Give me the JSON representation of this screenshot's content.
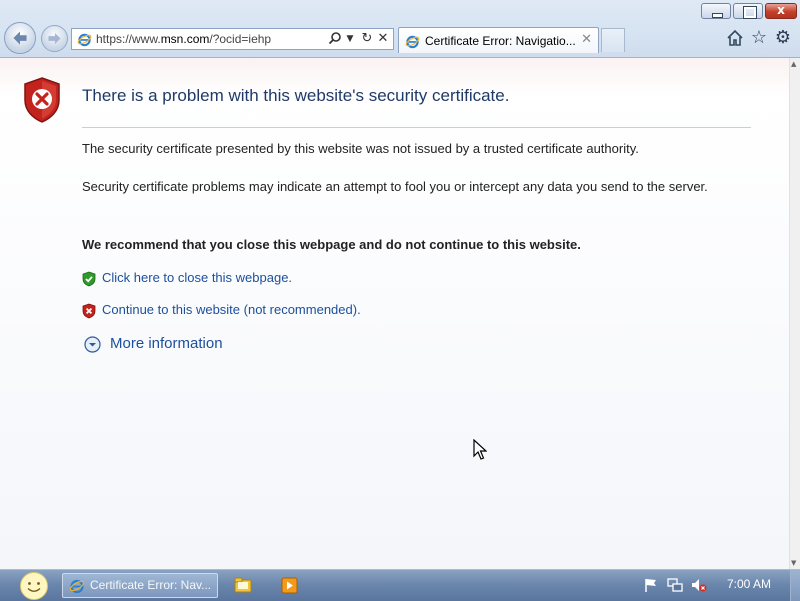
{
  "browser": {
    "address_url_prefix": "https://www.",
    "address_url_domain": "msn.com",
    "address_url_suffix": "/?ocid=iehp",
    "tab_title": "Certificate Error: Navigatio...",
    "window_buttons": {
      "close_glyph": "x"
    }
  },
  "page": {
    "title": "There is a problem with this website's security certificate.",
    "paragraph_1": "The security certificate presented by this website was not issued by a trusted certificate authority.",
    "paragraph_2": "Security certificate problems may indicate an attempt to fool you or intercept any data you send to the server.",
    "recommendation": "We recommend that you close this webpage and do not continue to this website.",
    "close_link": "Click here to close this webpage.",
    "continue_link": "Continue to this website (not recommended).",
    "more_info": "More information"
  },
  "taskbar": {
    "task_ie_label": "Certificate Error: Nav...",
    "clock": "7:00 AM"
  },
  "icons": {
    "error_shield": "red-shield-x",
    "green_shield": "green-shield-check",
    "red_shield": "red-shield-x",
    "more_info": "circle-chevron-down",
    "nav_back": "arrow-left",
    "nav_forward": "arrow-right",
    "home": "house",
    "favorites": "star",
    "tools": "gear"
  },
  "colors": {
    "title": "#1f3a68",
    "link": "#1c4f9c",
    "error_red": "#c4221c",
    "ok_green": "#2f9a2a",
    "taskbar": "#6c87ad"
  }
}
